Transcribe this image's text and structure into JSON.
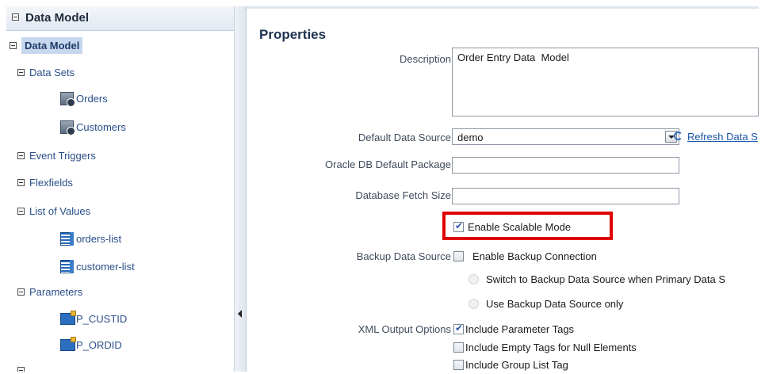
{
  "tree": {
    "header": "Data Model",
    "root": "Data Model",
    "nodes": {
      "data_sets": "Data Sets",
      "orders": "Orders",
      "customers": "Customers",
      "event_triggers": "Event Triggers",
      "flexfields": "Flexfields",
      "list_of_values": "List of Values",
      "orders_list": "orders-list",
      "customer_list": "customer-list",
      "parameters": "Parameters",
      "p_custid": "P_CUSTID",
      "p_ordid": "P_ORDID"
    }
  },
  "properties": {
    "title": "Properties",
    "description_label": "Description",
    "description_value": "Order Entry Data  Model",
    "default_ds_label": "Default Data Source",
    "default_ds_value": "demo",
    "refresh_link": "Refresh Data S",
    "oracle_pkg_label": "Oracle DB Default Package",
    "oracle_pkg_value": "",
    "fetch_size_label": "Database Fetch Size",
    "fetch_size_value": "",
    "scalable_mode_label": "Enable Scalable Mode",
    "scalable_mode_checked": true,
    "backup_ds_label": "Backup Data Source",
    "backup_conn_label": "Enable Backup Connection",
    "radio_switch_label": "Switch to Backup Data Source when Primary Data S",
    "radio_only_label": "Use Backup Data Source only",
    "xml_output_label": "XML Output Options",
    "xml_param_tags": "Include Parameter Tags",
    "xml_empty_tags": "Include Empty Tags for Null Elements",
    "xml_group_list": "Include Group List Tag"
  },
  "colors": {
    "highlight": "#e00000",
    "link": "#1a56a8",
    "selected_bg": "#c7d8ee"
  }
}
